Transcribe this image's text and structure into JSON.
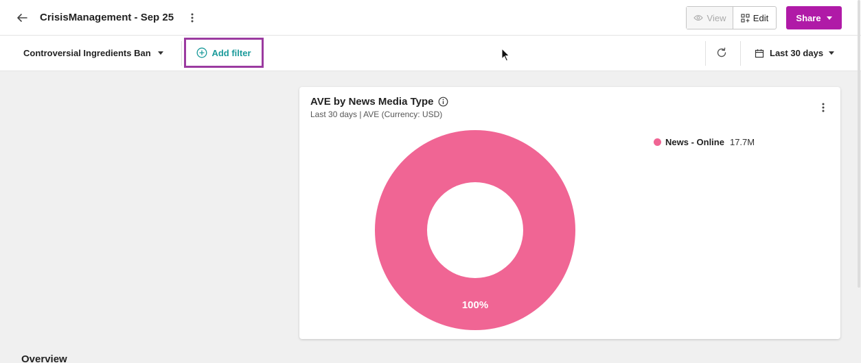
{
  "header": {
    "title": "CrisisManagement - Sep 25",
    "view_label": "View",
    "edit_label": "Edit",
    "share_label": "Share"
  },
  "filters": {
    "topic": "Controversial Ingredients Ban",
    "add_filter_label": "Add filter",
    "date_range": "Last 30 days"
  },
  "widget": {
    "title": "AVE by News Media Type",
    "subtitle": "Last 30 days | AVE (Currency: USD)",
    "slice_label": "100%",
    "legend": [
      {
        "label": "News - Online",
        "value": "17.7M",
        "color": "#f06594"
      }
    ]
  },
  "chart_data": {
    "type": "pie",
    "categories": [
      "News - Online"
    ],
    "values": [
      100
    ],
    "value_labels": [
      "17.7M"
    ],
    "title": "AVE by News Media Type",
    "subtitle": "Last 30 days | AVE (Currency: USD)",
    "legend_placement": "right"
  },
  "sections": {
    "overview": "Overview"
  },
  "colors": {
    "accent": "#b01aa7",
    "link": "#1a9a9a",
    "highlight_border": "#9b3aa0",
    "slice": "#f06594"
  },
  "icons": [
    "back-arrow-icon",
    "more-vertical-icon",
    "eye-icon",
    "edit-grid-icon",
    "plus-circle-icon",
    "refresh-icon",
    "calendar-icon",
    "info-icon"
  ]
}
